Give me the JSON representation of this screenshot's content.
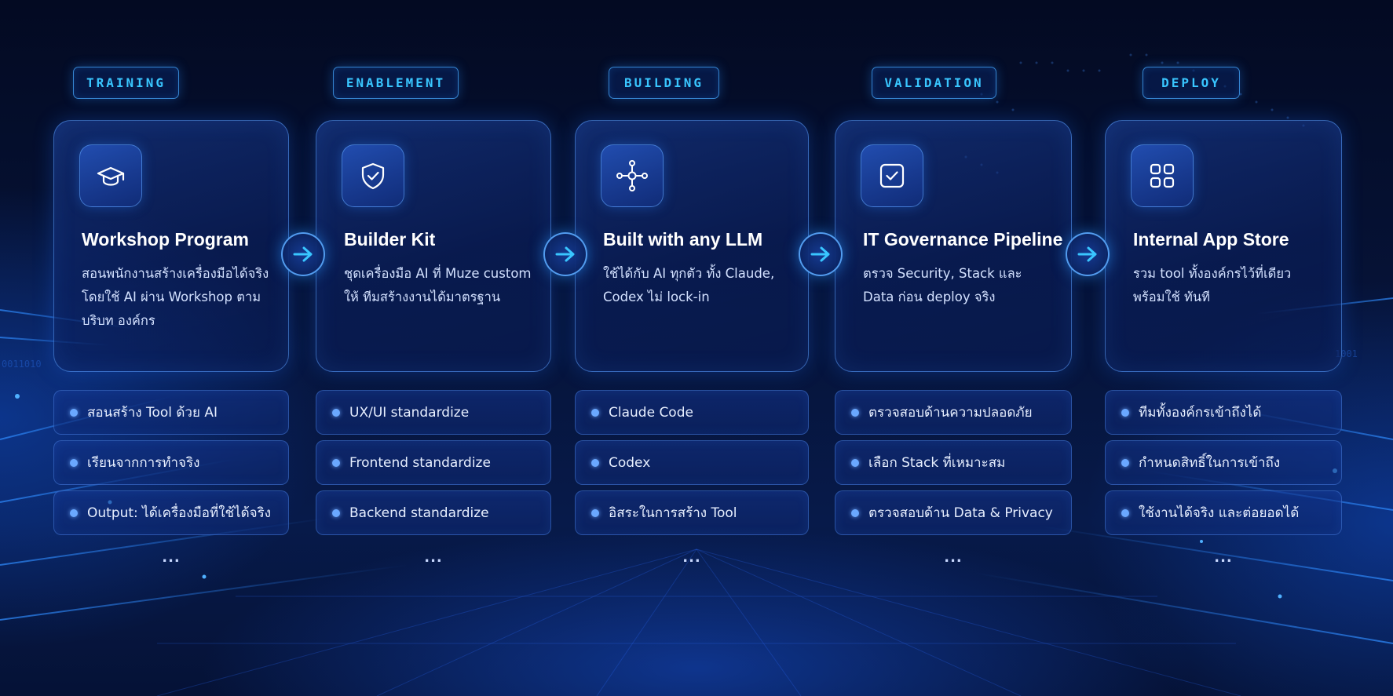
{
  "columns": [
    {
      "tag": "TRAINING",
      "icon": "graduation-cap-icon",
      "title": "Workshop Program",
      "description": "สอนพนักงานสร้างเครื่องมือได้จริง โดยใช้ AI ผ่าน Workshop ตามบริบท องค์กร",
      "items": [
        "สอนสร้าง Tool ด้วย AI",
        "เรียนจากการทำจริง",
        "Output: ได้เครื่องมือที่ใช้ได้จริง"
      ],
      "more": "..."
    },
    {
      "tag": "ENABLEMENT",
      "icon": "shield-check-icon",
      "title": "Builder Kit",
      "description": "ชุดเครื่องมือ AI ที่ Muze custom ให้ ทีมสร้างงานได้มาตรฐาน",
      "items": [
        "UX/UI standardize",
        "Frontend standardize",
        "Backend standardize"
      ],
      "more": "..."
    },
    {
      "tag": "BUILDING",
      "icon": "network-hub-icon",
      "title": "Built with any LLM",
      "description": "ใช้ได้กับ AI ทุกตัว ทั้ง Claude, Codex ไม่ lock-in",
      "items": [
        "Claude Code",
        "Codex",
        "อิสระในการสร้าง Tool"
      ],
      "more": "..."
    },
    {
      "tag": "VALIDATION",
      "icon": "checkbox-icon",
      "title": "IT Governance Pipeline",
      "description": "ตรวจ Security, Stack และ Data ก่อน deploy จริง",
      "items": [
        "ตรวจสอบด้านความปลอดภัย",
        "เลือก Stack ที่เหมาะสม",
        "ตรวจสอบด้าน Data & Privacy"
      ],
      "more": "..."
    },
    {
      "tag": "DEPLOY",
      "icon": "app-grid-icon",
      "title": "Internal App Store",
      "description": "รวม tool ทั้งองค์กรไว้ที่เดียว พร้อมใช้ ทันที",
      "items": [
        "ทีมทั้งองค์กรเข้าถึงได้",
        "กำหนดสิทธิ์ในการเข้าถึง",
        "ใช้งานได้จริง และต่อยอดได้"
      ],
      "more": "..."
    }
  ],
  "connectors": [
    "arrow-right-icon",
    "arrow-right-icon",
    "arrow-right-icon",
    "arrow-right-icon"
  ],
  "colors": {
    "accent": "#39c6ff",
    "background": "#061338",
    "card_border": "#5aa0ff",
    "bullet": "#6aa8ff"
  }
}
